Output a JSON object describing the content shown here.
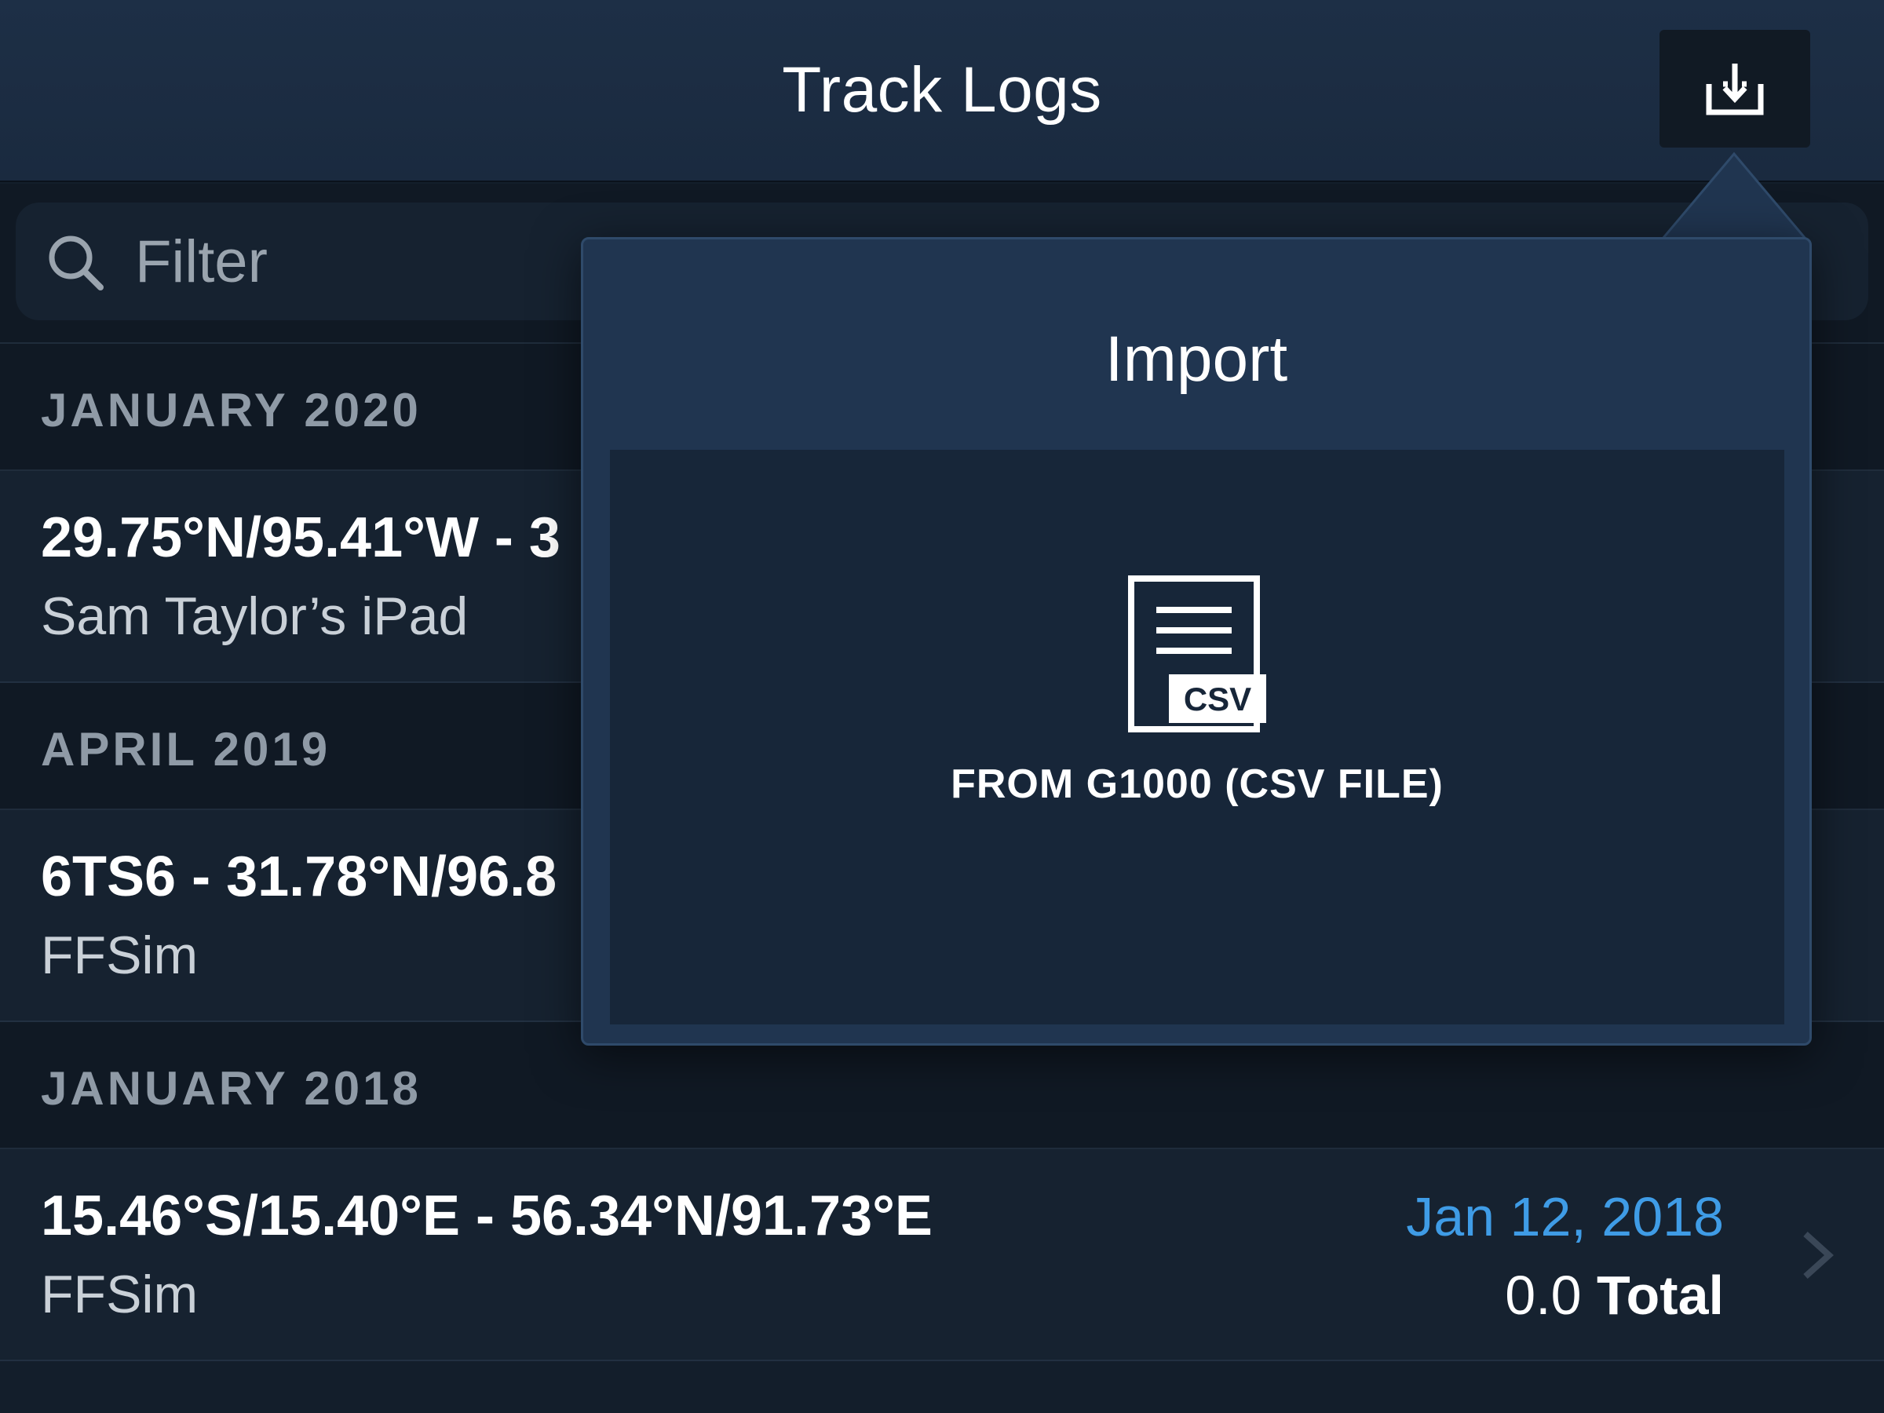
{
  "header": {
    "title": "Track Logs",
    "import_icon": "import-tray-arrow-icon"
  },
  "filter": {
    "placeholder": "Filter",
    "value": "",
    "icon": "search-icon"
  },
  "sections": [
    {
      "label": "JANUARY 2020",
      "rows": [
        {
          "title": "29.75°N/95.41°W - 3",
          "subtitle": "Sam Taylor’s iPad"
        }
      ]
    },
    {
      "label": "APRIL 2019",
      "rows": [
        {
          "title": "6TS6 - 31.78°N/96.8",
          "subtitle": "FFSim"
        }
      ]
    },
    {
      "label": "JANUARY 2018",
      "rows": [
        {
          "title": "15.46°S/15.40°E - 56.34°N/91.73°E",
          "subtitle": "FFSim",
          "date": "Jan 12, 2018",
          "total_value": "0.0",
          "total_word": "Total"
        }
      ]
    }
  ],
  "popover": {
    "title": "Import",
    "option": {
      "icon": "csv-file-icon",
      "icon_text": "CSV",
      "label": "FROM G1000 (CSV FILE)"
    }
  },
  "colors": {
    "accent_blue": "#3f9ce6",
    "popover_bg": "#203550",
    "list_bg": "#162230"
  }
}
